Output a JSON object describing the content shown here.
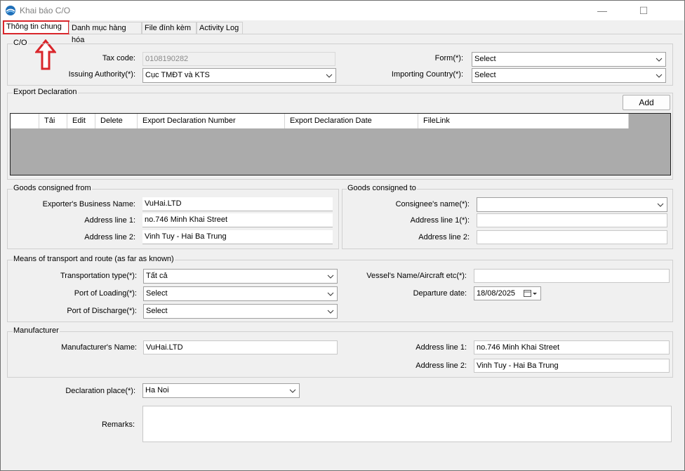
{
  "window": {
    "title": "Khai báo C/O",
    "minimize": "—",
    "maximize": "☐",
    "close": "✕"
  },
  "tabs": [
    "Thông tin chung",
    "Danh mục hàng hóa",
    "File đính kèm",
    "Activity Log"
  ],
  "co": {
    "group": "C/O",
    "tax_code_label": "Tax code:",
    "tax_code": "0108190282",
    "issuing_label": "Issuing Authority(*):",
    "issuing_value": "Cục TMĐT và KTS",
    "form_label": "Form(*):",
    "form_value": "Select",
    "importing_label": "Importing Country(*):",
    "importing_value": "Select"
  },
  "export_declaration": {
    "group": "Export Declaration",
    "add_button": "Add",
    "columns": [
      "",
      "Tải",
      "Edit",
      "Delete",
      "Export Declaration Number",
      "Export Declaration Date",
      "FileLink"
    ]
  },
  "goods_from": {
    "group": "Goods consigned from",
    "name_label": "Exporter's Business Name:",
    "name_value": "VuHai.LTD",
    "addr1_label": "Address line 1:",
    "addr1_value": "no.746 Minh Khai Street",
    "addr2_label": "Address line 2:",
    "addr2_value": "Vinh Tuy - Hai Ba Trung"
  },
  "goods_to": {
    "group": "Goods consigned to",
    "name_label": "Consignee's name(*):",
    "name_value": "",
    "addr1_label": "Address line 1(*):",
    "addr1_value": "",
    "addr2_label": "Address line 2:",
    "addr2_value": ""
  },
  "transport": {
    "group": "Means of transport and route (as far as known)",
    "type_label": "Transportation type(*):",
    "type_value": "Tất cả",
    "loading_label": "Port of Loading(*):",
    "loading_value": "Select",
    "discharge_label": "Port of Discharge(*):",
    "discharge_value": "Select",
    "vessel_label": "Vessel's Name/Aircraft etc(*):",
    "vessel_value": "",
    "departure_label": "Departure date:",
    "departure_value": "18/08/2025"
  },
  "manufacturer": {
    "group": "Manufacturer",
    "name_label": "Manufacturer's Name:",
    "name_value": "VuHai.LTD",
    "addr1_label": "Address line 1:",
    "addr1_value": "no.746 Minh Khai Street",
    "addr2_label": "Address line 2:",
    "addr2_value": "Vinh Tuy - Hai Ba Trung"
  },
  "declaration_place": {
    "label": "Declaration place(*):",
    "value": "Ha Noi"
  },
  "remarks": {
    "label": "Remarks:",
    "value": ""
  },
  "colors": {
    "highlight": "#d9262b",
    "grid_bg": "#ababab"
  }
}
